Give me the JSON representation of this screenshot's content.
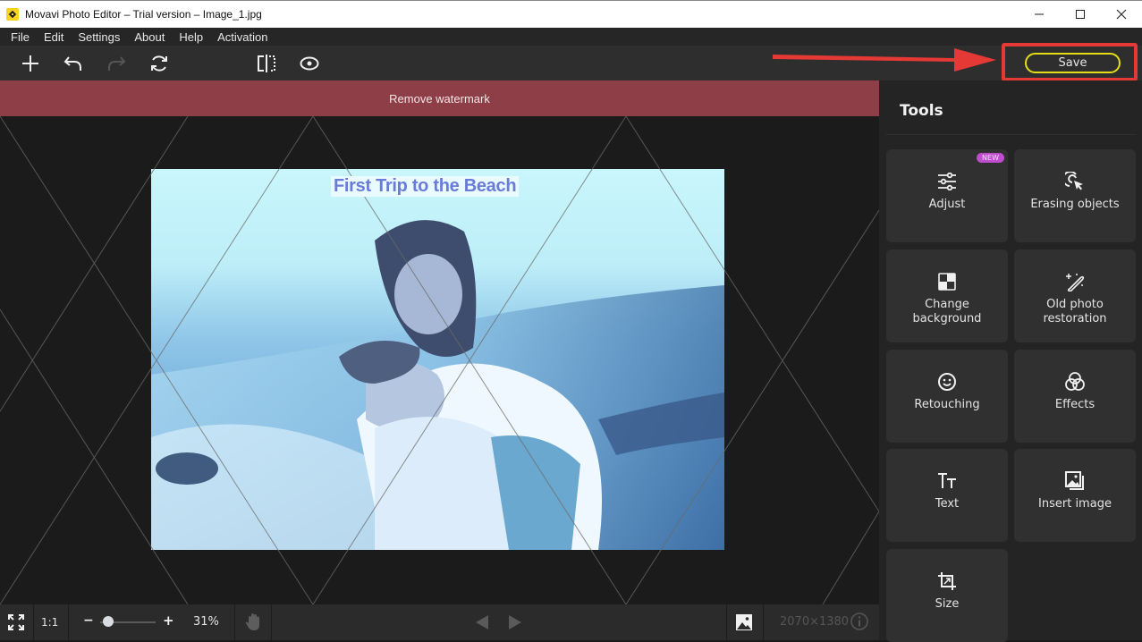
{
  "window": {
    "title": "Movavi Photo Editor – Trial version – Image_1.jpg",
    "controls": {
      "minimize": "—",
      "maximize": "☐",
      "close": "✕"
    }
  },
  "menu": [
    "File",
    "Edit",
    "Settings",
    "About",
    "Help",
    "Activation"
  ],
  "toolbar": {
    "icons": [
      "add-icon",
      "undo-icon",
      "redo-icon",
      "reset-icon",
      "compare-icon",
      "preview-eye-icon"
    ],
    "save_label": "Save"
  },
  "banner": {
    "remove_watermark": "Remove watermark"
  },
  "photo": {
    "caption": "First Trip to the Beach"
  },
  "bottombar": {
    "fullscreen_icon": "fit-screen-icon",
    "ratio_label": "1:1",
    "zoom_minus": "−",
    "zoom_plus": "+",
    "zoom_value": 0.31,
    "zoom_percent": "31%",
    "dimensions": "2070×1380"
  },
  "sidebar": {
    "title": "Tools",
    "tools": [
      {
        "label": "Adjust",
        "icon": "sliders-icon",
        "badge": "NEW"
      },
      {
        "label": "Erasing objects",
        "icon": "eraser-target-icon"
      },
      {
        "label": "Change background",
        "icon": "background-checker-icon"
      },
      {
        "label": "Old photo restoration",
        "icon": "magic-wand-icon"
      },
      {
        "label": "Retouching",
        "icon": "smiley-icon"
      },
      {
        "label": "Effects",
        "icon": "effects-circles-icon"
      },
      {
        "label": "Text",
        "icon": "text-icon"
      },
      {
        "label": "Insert image",
        "icon": "insert-image-icon"
      },
      {
        "label": "Size",
        "icon": "crop-resize-icon"
      }
    ]
  },
  "colors": {
    "accent_save_outline": "#e4dc16",
    "annotation_red": "#e53935",
    "watermark_bar": "#8e3e47",
    "new_badge": "#c04dd0"
  }
}
